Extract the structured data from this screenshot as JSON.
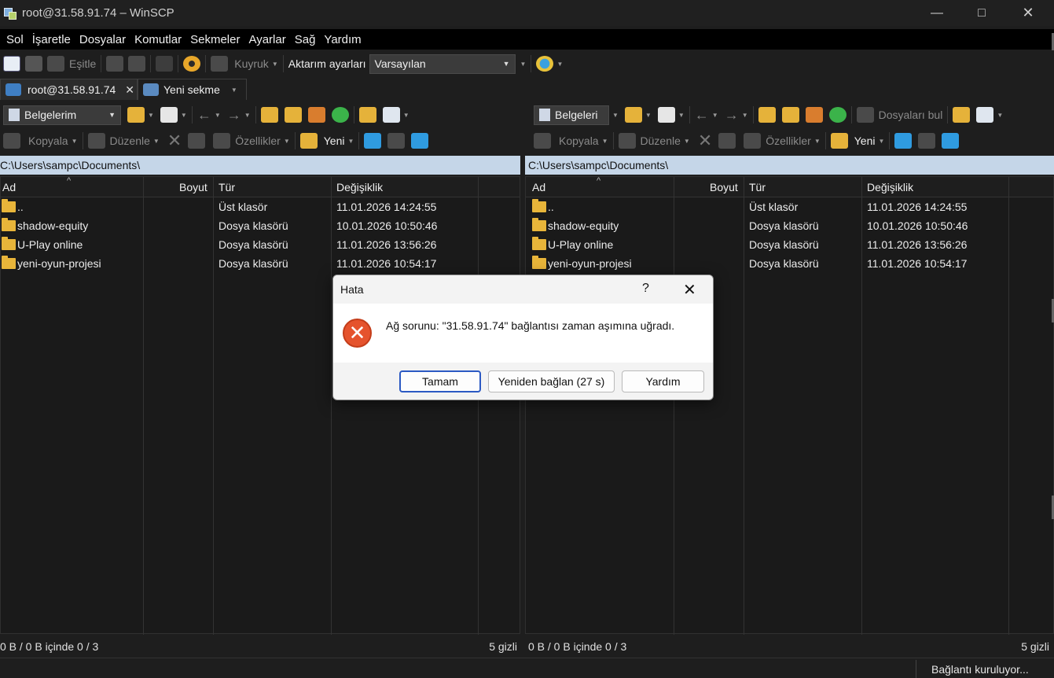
{
  "window": {
    "title": "root@31.58.91.74 – WinSCP"
  },
  "menu": [
    "Sol",
    "İşaretle",
    "Dosyalar",
    "Komutlar",
    "Sekmeler",
    "Ayarlar",
    "Sağ",
    "Yardım"
  ],
  "toolbar": {
    "sync_label": "Eşitle",
    "queue_label": "Kuyruk",
    "transfer_settings_label": "Aktarım ayarları",
    "transfer_preset": "Varsayılan"
  },
  "tabs": [
    {
      "label": "root@31.58.91.74",
      "close": "✕"
    },
    {
      "label": "Yeni sekme"
    }
  ],
  "left_panel": {
    "location": "Belgelerim",
    "copy_label": "Kopyala",
    "edit_label": "Düzenle",
    "properties_label": "Özellikler",
    "new_label": "Yeni",
    "path": "C:\\Users\\sampc\\Documents\\",
    "columns": {
      "name": "Ad",
      "size": "Boyut",
      "type": "Tür",
      "modified": "Değişiklik"
    },
    "rows": [
      {
        "name": "..",
        "type": "Üst klasör",
        "modified": "11.01.2026 14:24:55"
      },
      {
        "name": "shadow-equity",
        "type": "Dosya klasörü",
        "modified": "10.01.2026 10:50:46"
      },
      {
        "name": "U-Play online",
        "type": "Dosya klasörü",
        "modified": "11.01.2026 13:56:26"
      },
      {
        "name": "yeni-oyun-projesi",
        "type": "Dosya klasörü",
        "modified": "11.01.2026 10:54:17"
      }
    ],
    "status_left": "0 B / 0 B içinde 0 / 3",
    "status_right": "5 gizli"
  },
  "right_panel": {
    "location": "Belgeleri",
    "find_files_label": "Dosyaları bul",
    "copy_label": "Kopyala",
    "edit_label": "Düzenle",
    "properties_label": "Özellikler",
    "new_label": "Yeni",
    "path": "C:\\Users\\sampc\\Documents\\",
    "columns": {
      "name": "Ad",
      "size": "Boyut",
      "type": "Tür",
      "modified": "Değişiklik"
    },
    "rows": [
      {
        "name": "..",
        "type": "Üst klasör",
        "modified": "11.01.2026 14:24:55"
      },
      {
        "name": "shadow-equity",
        "type": "Dosya klasörü",
        "modified": "10.01.2026 10:50:46"
      },
      {
        "name": "U-Play online",
        "type": "Dosya klasörü",
        "modified": "11.01.2026 13:56:26"
      },
      {
        "name": "yeni-oyun-projesi",
        "type": "Dosya klasörü",
        "modified": "11.01.2026 10:54:17"
      }
    ],
    "status_left": "0 B / 0 B içinde 0 / 3",
    "status_right": "5 gizli"
  },
  "statusbar": {
    "connection": "Bağlantı kuruluyor..."
  },
  "dialog": {
    "title": "Hata",
    "help_glyph": "?",
    "close_glyph": "✕",
    "error_glyph": "✕",
    "message": "Ağ sorunu: \"31.58.91.74\" bağlantısı zaman aşımına uğradı.",
    "ok_label": "Tamam",
    "reconnect_label": "Yeniden bağlan (27 s)",
    "help_label": "Yardım"
  }
}
